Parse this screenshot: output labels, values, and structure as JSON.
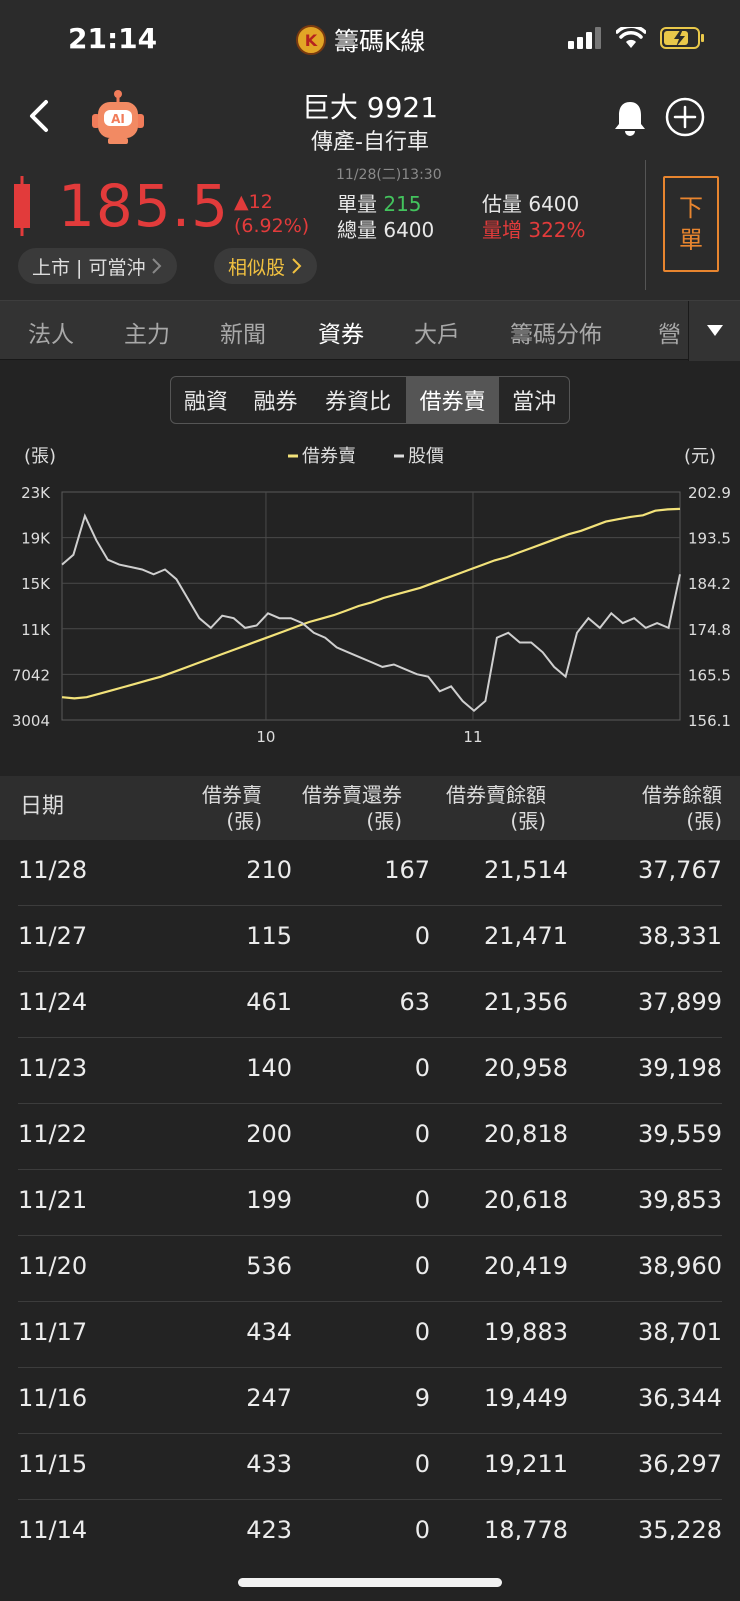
{
  "status_bar": {
    "time": "21:14",
    "app_name": "籌碼K線",
    "app_logo_letter": "K"
  },
  "header": {
    "title": "巨大 9921",
    "subtitle": "傳產-自行車",
    "robot_label": "AI",
    "timestamp": "11/28(二)13:30",
    "price": "185.5",
    "change": "▲12",
    "change_pct": "(6.92%)",
    "single_vol_label": "單量",
    "single_vol": "215",
    "total_vol_label": "總量",
    "total_vol": "6400",
    "est_vol_label": "估量",
    "est_vol": "6400",
    "vol_inc_label": "量增",
    "vol_inc": "322%",
    "order_button": [
      "下",
      "單"
    ],
    "tag_market": "上市 | 可當沖",
    "tag_similar": "相似股",
    "colors": {
      "up": "#e23b3b",
      "green": "#43c35d",
      "accent": "#e8852f",
      "gold": "#f0c040"
    }
  },
  "tabs": [
    "法人",
    "主力",
    "新聞",
    "資券",
    "大戶",
    "籌碼分佈",
    "營"
  ],
  "active_tab": "資券",
  "segments": [
    "融資",
    "融券",
    "券資比",
    "借券賣",
    "當沖"
  ],
  "active_segment": "借券賣",
  "chart_data": {
    "type": "line",
    "left_unit": "(張)",
    "right_unit": "(元)",
    "legend": [
      "借券賣",
      "股價"
    ],
    "y_left_ticks": [
      "23K",
      "19K",
      "15K",
      "11K",
      "7042",
      "3004"
    ],
    "y_left_range": [
      3004,
      23000
    ],
    "y_right_ticks": [
      "202.9",
      "193.5",
      "184.2",
      "174.8",
      "165.5",
      "156.1"
    ],
    "y_right_range": [
      156.1,
      202.9
    ],
    "x_ticks": [
      "10",
      "11"
    ],
    "grid": true,
    "legend_position": "top-center",
    "series": [
      {
        "name": "借券賣",
        "color": "#f2e27a",
        "axis": "left",
        "values": [
          5000,
          4900,
          5000,
          5300,
          5600,
          5900,
          6200,
          6500,
          6800,
          7200,
          7600,
          8000,
          8400,
          8800,
          9200,
          9600,
          10000,
          10400,
          10800,
          11200,
          11600,
          11900,
          12200,
          12600,
          13000,
          13300,
          13700,
          14000,
          14300,
          14600,
          15000,
          15400,
          15800,
          16200,
          16600,
          17000,
          17300,
          17700,
          18100,
          18500,
          18900,
          19300,
          19600,
          20000,
          20400,
          20618,
          20818,
          20958,
          21356,
          21471,
          21514
        ]
      },
      {
        "name": "股價",
        "color": "#cfcfcf",
        "axis": "right",
        "values": [
          188,
          190,
          198,
          193,
          189,
          188,
          187.5,
          187,
          186,
          187,
          185,
          181,
          177,
          175,
          177.5,
          177,
          175,
          175.5,
          178,
          177,
          177,
          176,
          174,
          173,
          171,
          170,
          169,
          168,
          167,
          167.5,
          166.5,
          165.5,
          165,
          162,
          163,
          160,
          158,
          160,
          173,
          174,
          172,
          172,
          170,
          167,
          165,
          174,
          177,
          175,
          178,
          176,
          177,
          175,
          176,
          175,
          186
        ]
      }
    ]
  },
  "table": {
    "headers": [
      {
        "l1": "日期",
        "l2": ""
      },
      {
        "l1": "借券賣",
        "l2": "(張)"
      },
      {
        "l1": "借券賣還券",
        "l2": "(張)"
      },
      {
        "l1": "借券賣餘額",
        "l2": "(張)"
      },
      {
        "l1": "借券餘額",
        "l2": "(張)"
      }
    ],
    "rows": [
      [
        "11/28",
        "210",
        "167",
        "21,514",
        "37,767"
      ],
      [
        "11/27",
        "115",
        "0",
        "21,471",
        "38,331"
      ],
      [
        "11/24",
        "461",
        "63",
        "21,356",
        "37,899"
      ],
      [
        "11/23",
        "140",
        "0",
        "20,958",
        "39,198"
      ],
      [
        "11/22",
        "200",
        "0",
        "20,818",
        "39,559"
      ],
      [
        "11/21",
        "199",
        "0",
        "20,618",
        "39,853"
      ],
      [
        "11/20",
        "536",
        "0",
        "20,419",
        "38,960"
      ],
      [
        "11/17",
        "434",
        "0",
        "19,883",
        "38,701"
      ],
      [
        "11/16",
        "247",
        "9",
        "19,449",
        "36,344"
      ],
      [
        "11/15",
        "433",
        "0",
        "19,211",
        "36,297"
      ],
      [
        "11/14",
        "423",
        "0",
        "18,778",
        "35,228"
      ]
    ]
  }
}
